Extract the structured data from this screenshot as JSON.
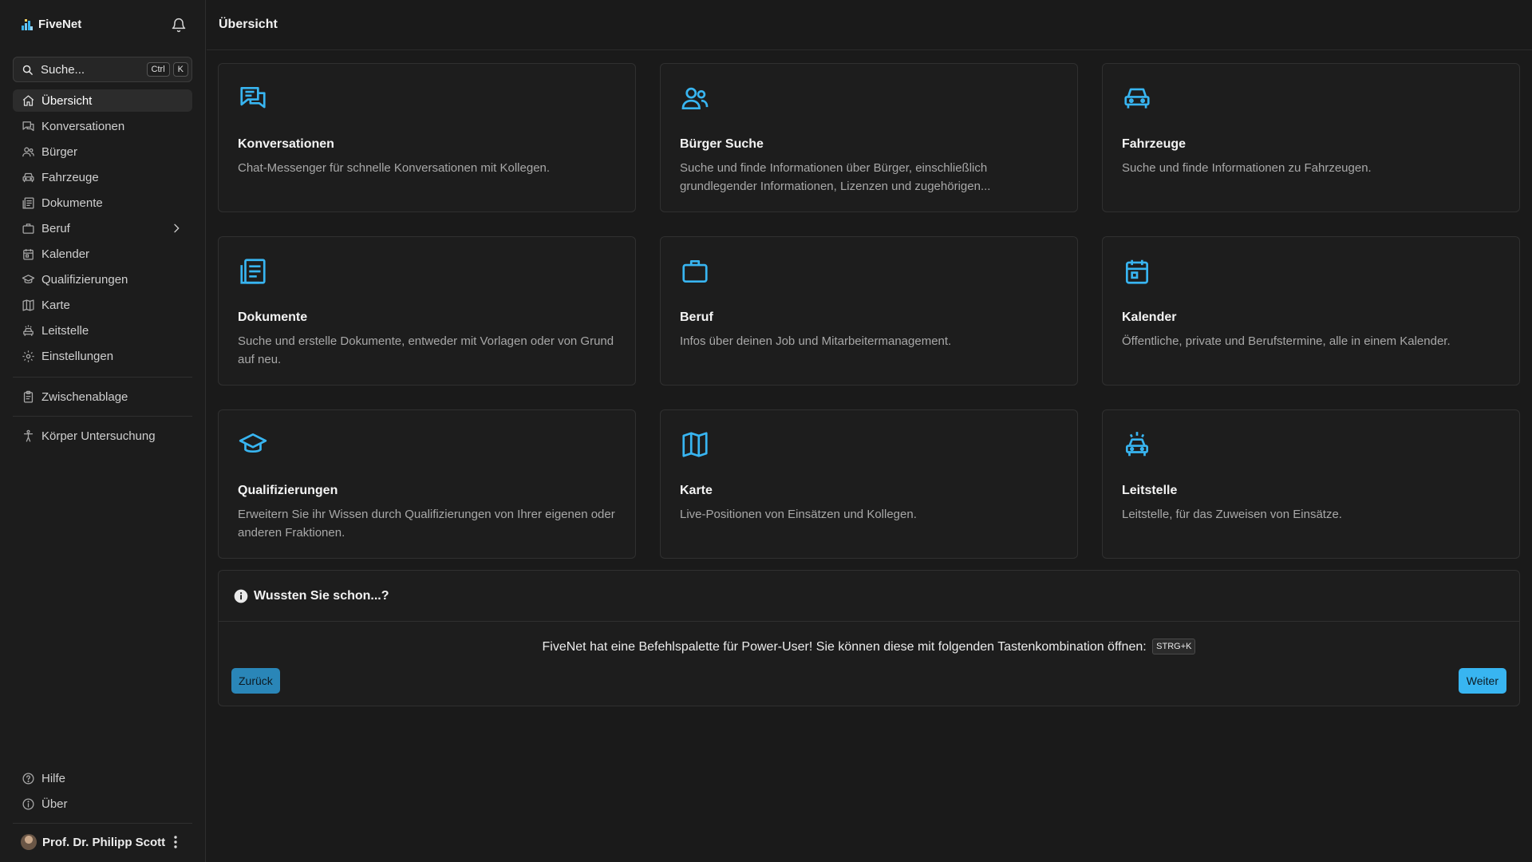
{
  "app": {
    "name": "FiveNet"
  },
  "colors": {
    "accent": "#38b5f1",
    "background": "#1a1a1a",
    "sidebar": "#1c1c1c",
    "card": "#1d1d1d"
  },
  "search": {
    "placeholder": "Suche...",
    "shortcut_keys": [
      "Ctrl",
      "K"
    ]
  },
  "sidebar": {
    "items": [
      {
        "label": "Übersicht",
        "icon": "home-icon",
        "active": true
      },
      {
        "label": "Konversationen",
        "icon": "chat-icon"
      },
      {
        "label": "Bürger",
        "icon": "users-icon"
      },
      {
        "label": "Fahrzeuge",
        "icon": "car-icon"
      },
      {
        "label": "Dokumente",
        "icon": "document-icon"
      },
      {
        "label": "Beruf",
        "icon": "briefcase-icon",
        "has_submenu": true
      },
      {
        "label": "Kalender",
        "icon": "calendar-icon"
      },
      {
        "label": "Qualifizierungen",
        "icon": "graduation-cap-icon"
      },
      {
        "label": "Karte",
        "icon": "map-icon"
      },
      {
        "label": "Leitstelle",
        "icon": "dispatch-car-icon"
      },
      {
        "label": "Einstellungen",
        "icon": "gear-icon"
      }
    ],
    "extra": [
      {
        "label": "Zwischenablage",
        "icon": "clipboard-icon"
      },
      {
        "label": "Körper Untersuchung",
        "icon": "body-icon"
      }
    ],
    "bottom": [
      {
        "label": "Hilfe",
        "icon": "help-icon"
      },
      {
        "label": "Über",
        "icon": "info-icon"
      }
    ],
    "user": {
      "name": "Prof. Dr. Philipp Scott"
    }
  },
  "header": {
    "title": "Übersicht"
  },
  "cards": [
    {
      "title": "Konversationen",
      "description": "Chat-Messenger für schnelle Konversationen mit Kollegen.",
      "icon": "chat-icon"
    },
    {
      "title": "Bürger Suche",
      "description": "Suche und finde Informationen über Bürger, einschließlich grundlegender Informationen, Lizenzen und zugehörigen...",
      "icon": "users-icon"
    },
    {
      "title": "Fahrzeuge",
      "description": "Suche und finde Informationen zu Fahrzeugen.",
      "icon": "car-icon"
    },
    {
      "title": "Dokumente",
      "description": "Suche und erstelle Dokumente, entweder mit Vorlagen oder von Grund auf neu.",
      "icon": "document-icon"
    },
    {
      "title": "Beruf",
      "description": "Infos über deinen Job und Mitarbeitermanagement.",
      "icon": "briefcase-icon"
    },
    {
      "title": "Kalender",
      "description": "Öffentliche, private und Berufstermine, alle in einem Kalender.",
      "icon": "calendar-icon"
    },
    {
      "title": "Qualifizierungen",
      "description": "Erweitern Sie ihr Wissen durch Qualifizierungen von Ihrer eigenen oder anderen Fraktionen.",
      "icon": "graduation-cap-icon"
    },
    {
      "title": "Karte",
      "description": "Live-Positionen von Einsätzen und Kollegen.",
      "icon": "map-icon"
    },
    {
      "title": "Leitstelle",
      "description": "Leitstelle, für das Zuweisen von Einsätze.",
      "icon": "dispatch-car-icon"
    }
  ],
  "tip": {
    "title": "Wussten Sie schon...?",
    "text": "FiveNet hat eine Befehlspalette für Power-User! Sie können diese mit folgenden Tastenkombination öffnen:",
    "shortcut": "STRG+K",
    "back_label": "Zurück",
    "next_label": "Weiter"
  }
}
